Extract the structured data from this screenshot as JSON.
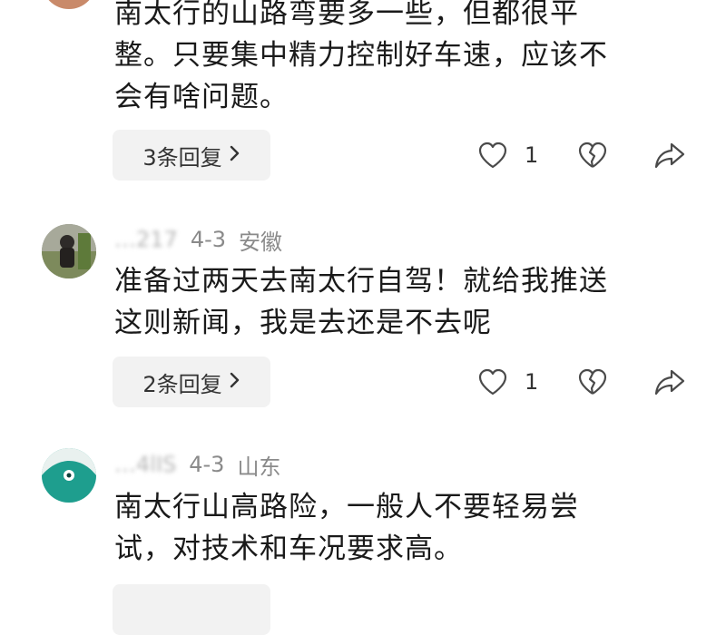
{
  "colors": {
    "text_primary": "#1a1a1a",
    "text_meta": "#8a8a8a",
    "reply_bg": "#f2f2f2",
    "icon_stroke": "#4a4a4a"
  },
  "comments": [
    {
      "username": "",
      "date": "",
      "location": "",
      "text_lines": [
        "南太行的山路弯要多一些，但都很平",
        "整。只要集中精力控制好车速，应该不",
        "会有啥问题。"
      ],
      "reply_label": "3条回复",
      "like_count": "1",
      "icons": {
        "like": "heart-icon",
        "dislike": "broken-heart-icon",
        "share": "share-arrow-icon",
        "chevron": "chevron-right-icon"
      }
    },
    {
      "username": "…217",
      "date": "4-3",
      "location": "安徽",
      "text_lines": [
        "准备过两天去南太行自驾！就给我推送",
        "这则新闻，我是去还是不去呢"
      ],
      "reply_label": "2条回复",
      "like_count": "1",
      "icons": {
        "like": "heart-icon",
        "dislike": "broken-heart-icon",
        "share": "share-arrow-icon",
        "chevron": "chevron-right-icon"
      }
    },
    {
      "username": "…4lIS",
      "date": "4-3",
      "location": "山东",
      "text_lines": [
        "南太行山高路险，一般人不要轻易尝",
        "试，对技术和车况要求高。"
      ],
      "reply_label": "",
      "like_count": "",
      "icons": {}
    }
  ]
}
